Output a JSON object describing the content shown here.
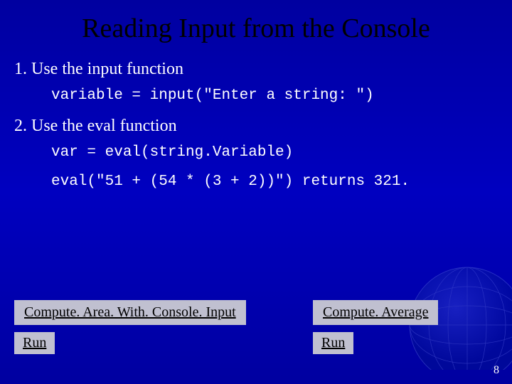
{
  "title": "Reading Input from the Console",
  "items": [
    {
      "label": "1. Use the input function",
      "code": [
        "variable = input(\"Enter a string: \")"
      ]
    },
    {
      "label": "2. Use the eval function",
      "code": [
        "var = eval(string.Variable)",
        "eval(\"51 + (54 * (3 + 2))\") returns 321."
      ]
    }
  ],
  "buttons": {
    "left": {
      "main": "Compute. Area. With. Console. Input",
      "sub": "Run"
    },
    "right": {
      "main": "Compute. Average",
      "sub": "Run"
    }
  },
  "page_number": "8"
}
